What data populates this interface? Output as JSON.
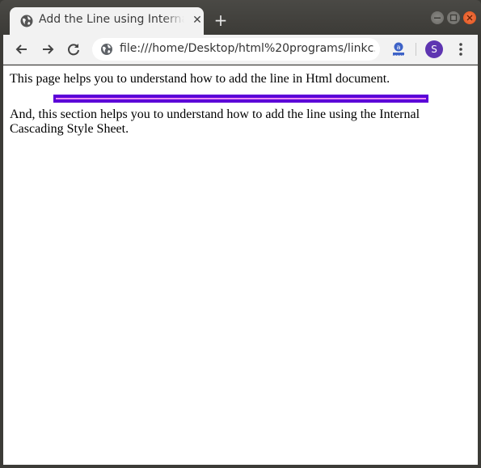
{
  "browser": {
    "tab": {
      "title": "Add the Line using Internal Cascading Style Sheet",
      "favicon": "globe-icon",
      "close_glyph": "✕"
    },
    "new_tab_glyph": "+",
    "window_controls": [
      "minimize",
      "maximize",
      "close"
    ],
    "toolbar": {
      "back": "arrow-left-icon",
      "forward": "arrow-right-icon",
      "reload": "reload-icon",
      "url": "file:///home/Desktop/html%20programs/linkc...",
      "site_info_icon": "globe-icon",
      "extension_icon": "reader-extension-icon",
      "profile_initial": "S",
      "profile_color": "#5e35b1",
      "menu_icon": "kebab-menu-icon"
    }
  },
  "page": {
    "paragraph1": "This page helps you to understand how to add the line in Html document.",
    "hr": {
      "color": "#5b00d8",
      "inner_color": "#e98bf2"
    },
    "paragraph2": "And, this section helps you to understand how to add the line using the Internal Cascading Style Sheet."
  }
}
